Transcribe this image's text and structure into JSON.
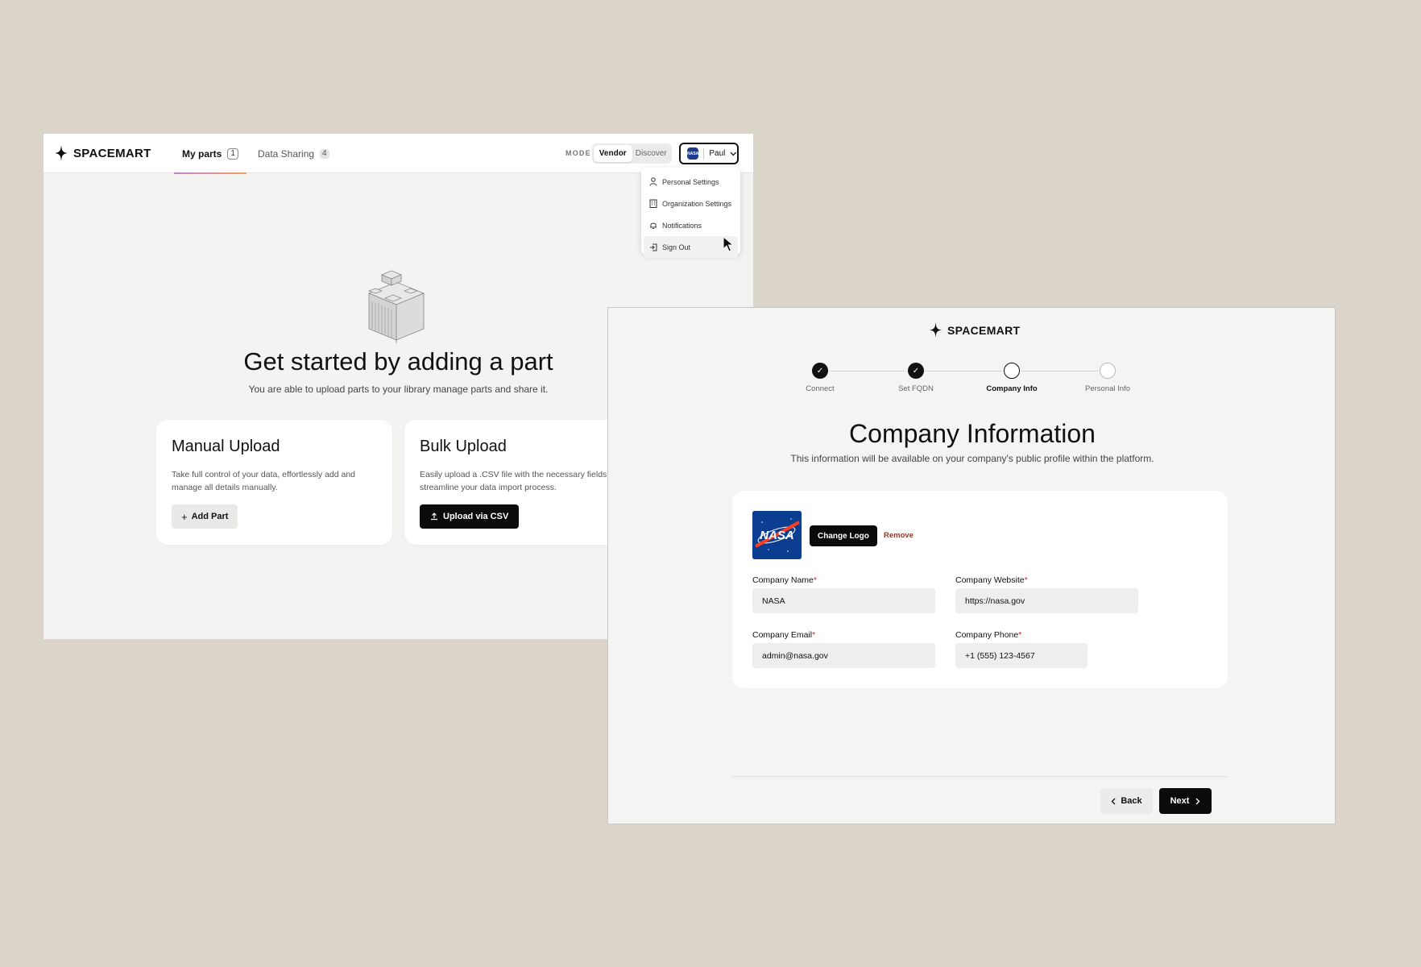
{
  "dashboard": {
    "brand": "SPACEMART",
    "tabs": [
      {
        "label": "My parts",
        "count": "1"
      },
      {
        "label": "Data Sharing",
        "count": "4"
      }
    ],
    "mode_label": "MODE",
    "mode_options": [
      "Vendor",
      "Discover"
    ],
    "selected_mode": "Vendor",
    "user": {
      "name": "Paul",
      "avatar_text": "NASA"
    },
    "user_menu": [
      {
        "label": "Personal Settings",
        "icon": "user-icon"
      },
      {
        "label": "Organization Settings",
        "icon": "building-icon"
      },
      {
        "label": "Notifications",
        "icon": "bell-icon"
      },
      {
        "label": "Sign Out",
        "icon": "sign-out-icon"
      }
    ],
    "hero": {
      "title": "Get started by adding a part",
      "subtitle": "You are able to upload parts to your library manage parts and share it."
    },
    "cards": [
      {
        "title": "Manual Upload",
        "description": "Take full control of your data, effortlessly add and manage all details manually.",
        "button": "Add Part"
      },
      {
        "title": "Bulk Upload",
        "description": "Easily upload a .CSV file with the necessary fields streamline your data import process.",
        "button": "Upload via CSV"
      }
    ]
  },
  "onboarding": {
    "brand": "SPACEMART",
    "steps": [
      {
        "label": "Connect",
        "state": "done"
      },
      {
        "label": "Set FQDN",
        "state": "done"
      },
      {
        "label": "Company Info",
        "state": "current"
      },
      {
        "label": "Personal Info",
        "state": "todo"
      }
    ],
    "title": "Company Information",
    "subtitle": "This information will be available on your company's public profile within the platform.",
    "logo_text": "NASA",
    "change_logo": "Change Logo",
    "remove": "Remove",
    "fields": [
      {
        "label": "Company Name",
        "value": "NASA"
      },
      {
        "label": "Company Website",
        "value": "https://nasa.gov"
      },
      {
        "label": "Company Email",
        "value": "admin@nasa.gov"
      },
      {
        "label": "Company Phone",
        "value": "+1 (555) 123-4567"
      }
    ],
    "back": "Back",
    "next": "Next"
  },
  "colors": {
    "background": "#dbd4c8",
    "primary_button": "#0b0b0b",
    "remove_link": "#8b3a2e",
    "required": "#dd2233",
    "tab_underline": [
      "#c583d8",
      "#f0a060"
    ]
  }
}
